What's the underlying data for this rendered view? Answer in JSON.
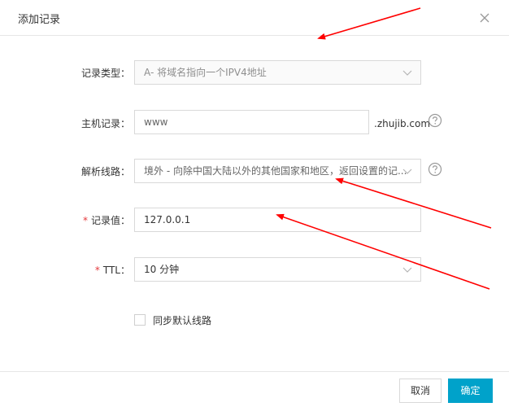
{
  "dialog": {
    "title": "添加记录",
    "close_label": "×"
  },
  "form": {
    "record_type": {
      "label": "记录类型：",
      "value": "A- 将域名指向一个IPV4地址"
    },
    "host": {
      "label": "主机记录：",
      "value": "www",
      "suffix": ".zhujib.com"
    },
    "line": {
      "label": "解析线路：",
      "value": "境外 - 向除中国大陆以外的其他国家和地区，返回设置的记..."
    },
    "record_value": {
      "required_mark": "*",
      "label": "记录值：",
      "value": "127.0.0.1"
    },
    "ttl": {
      "required_mark": "*",
      "label": "TTL：",
      "value": "10 分钟"
    },
    "sync_default": {
      "label": "同步默认线路"
    }
  },
  "footer": {
    "cancel_label": "取消",
    "ok_label": "确定"
  },
  "colors": {
    "primary": "#00a2ca",
    "required": "#e4393c",
    "annotation_arrow": "#ff0000"
  }
}
